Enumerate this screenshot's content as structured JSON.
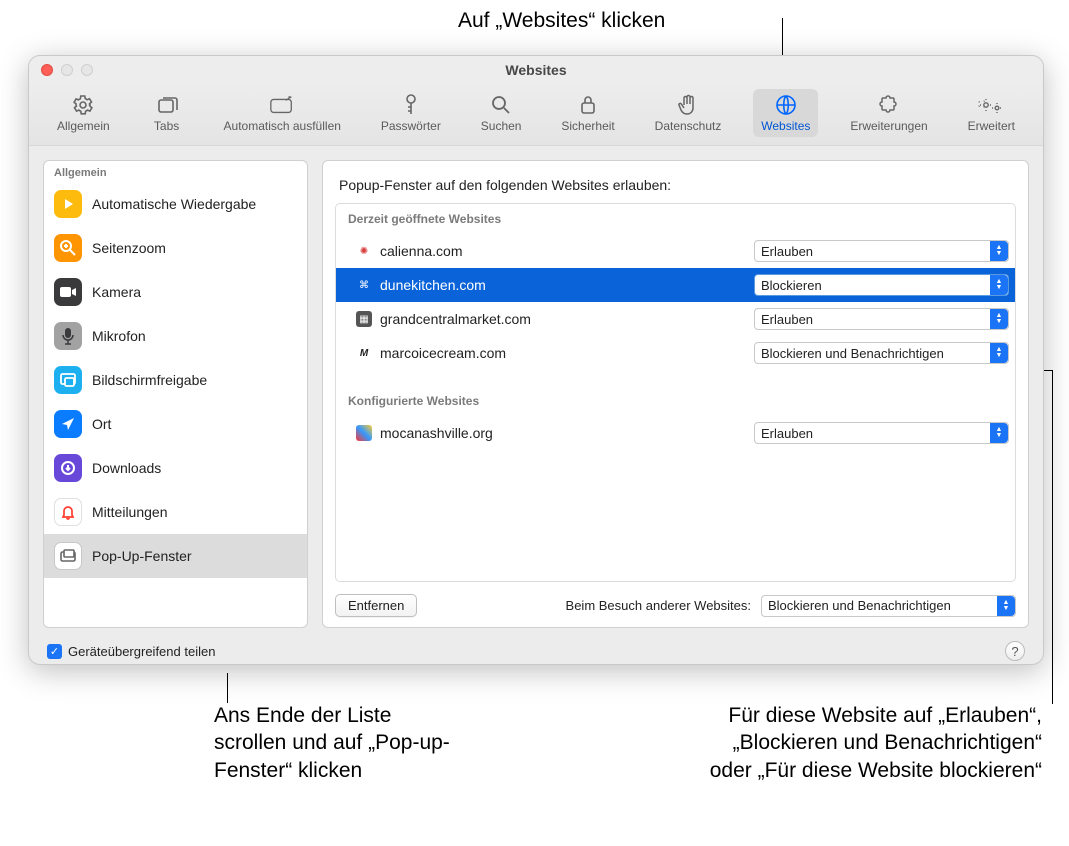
{
  "window": {
    "title": "Websites"
  },
  "tabs": [
    {
      "label": "Allgemein",
      "name": "tab-general"
    },
    {
      "label": "Tabs",
      "name": "tab-tabs"
    },
    {
      "label": "Automatisch ausfüllen",
      "name": "tab-autofill"
    },
    {
      "label": "Passwörter",
      "name": "tab-passwords"
    },
    {
      "label": "Suchen",
      "name": "tab-search"
    },
    {
      "label": "Sicherheit",
      "name": "tab-security"
    },
    {
      "label": "Datenschutz",
      "name": "tab-privacy"
    },
    {
      "label": "Websites",
      "name": "tab-websites"
    },
    {
      "label": "Erweiterungen",
      "name": "tab-extensions"
    },
    {
      "label": "Erweitert",
      "name": "tab-advanced"
    }
  ],
  "sidebar": {
    "section": "Allgemein",
    "items": [
      {
        "label": "Automatische Wiedergabe",
        "name": "sidebar-item-autoplay"
      },
      {
        "label": "Seitenzoom",
        "name": "sidebar-item-pagezoom"
      },
      {
        "label": "Kamera",
        "name": "sidebar-item-camera"
      },
      {
        "label": "Mikrofon",
        "name": "sidebar-item-microphone"
      },
      {
        "label": "Bildschirmfreigabe",
        "name": "sidebar-item-screenshare"
      },
      {
        "label": "Ort",
        "name": "sidebar-item-location"
      },
      {
        "label": "Downloads",
        "name": "sidebar-item-downloads"
      },
      {
        "label": "Mitteilungen",
        "name": "sidebar-item-notifications"
      },
      {
        "label": "Pop-Up-Fenster",
        "name": "sidebar-item-popups"
      }
    ]
  },
  "detail": {
    "heading": "Popup-Fenster auf den folgenden Websites erlauben:",
    "open_section": "Derzeit geöffnete Websites",
    "configured_section": "Konfigurierte Websites",
    "open_sites": [
      {
        "domain": "calienna.com",
        "value": "Erlauben"
      },
      {
        "domain": "dunekitchen.com",
        "value": "Blockieren"
      },
      {
        "domain": "grandcentralmarket.com",
        "value": "Erlauben"
      },
      {
        "domain": "marcoicecream.com",
        "value": "Blockieren und Benachrichtigen"
      }
    ],
    "configured_sites": [
      {
        "domain": "mocanashville.org",
        "value": "Erlauben"
      }
    ],
    "remove_button": "Entfernen",
    "other_label": "Beim Besuch anderer Websites:",
    "other_value": "Blockieren und Benachrichtigen"
  },
  "share_checkbox": "Geräteübergreifend teilen",
  "callouts": {
    "top": "Auf „Websites“ klicken",
    "left": "Ans Ende der Liste scrollen und auf „Pop-up-Fenster“ klicken",
    "right": "Für diese Website auf „Erlauben“, „Blockieren und Benachrichtigen“ oder „Für diese Website blockieren“"
  }
}
